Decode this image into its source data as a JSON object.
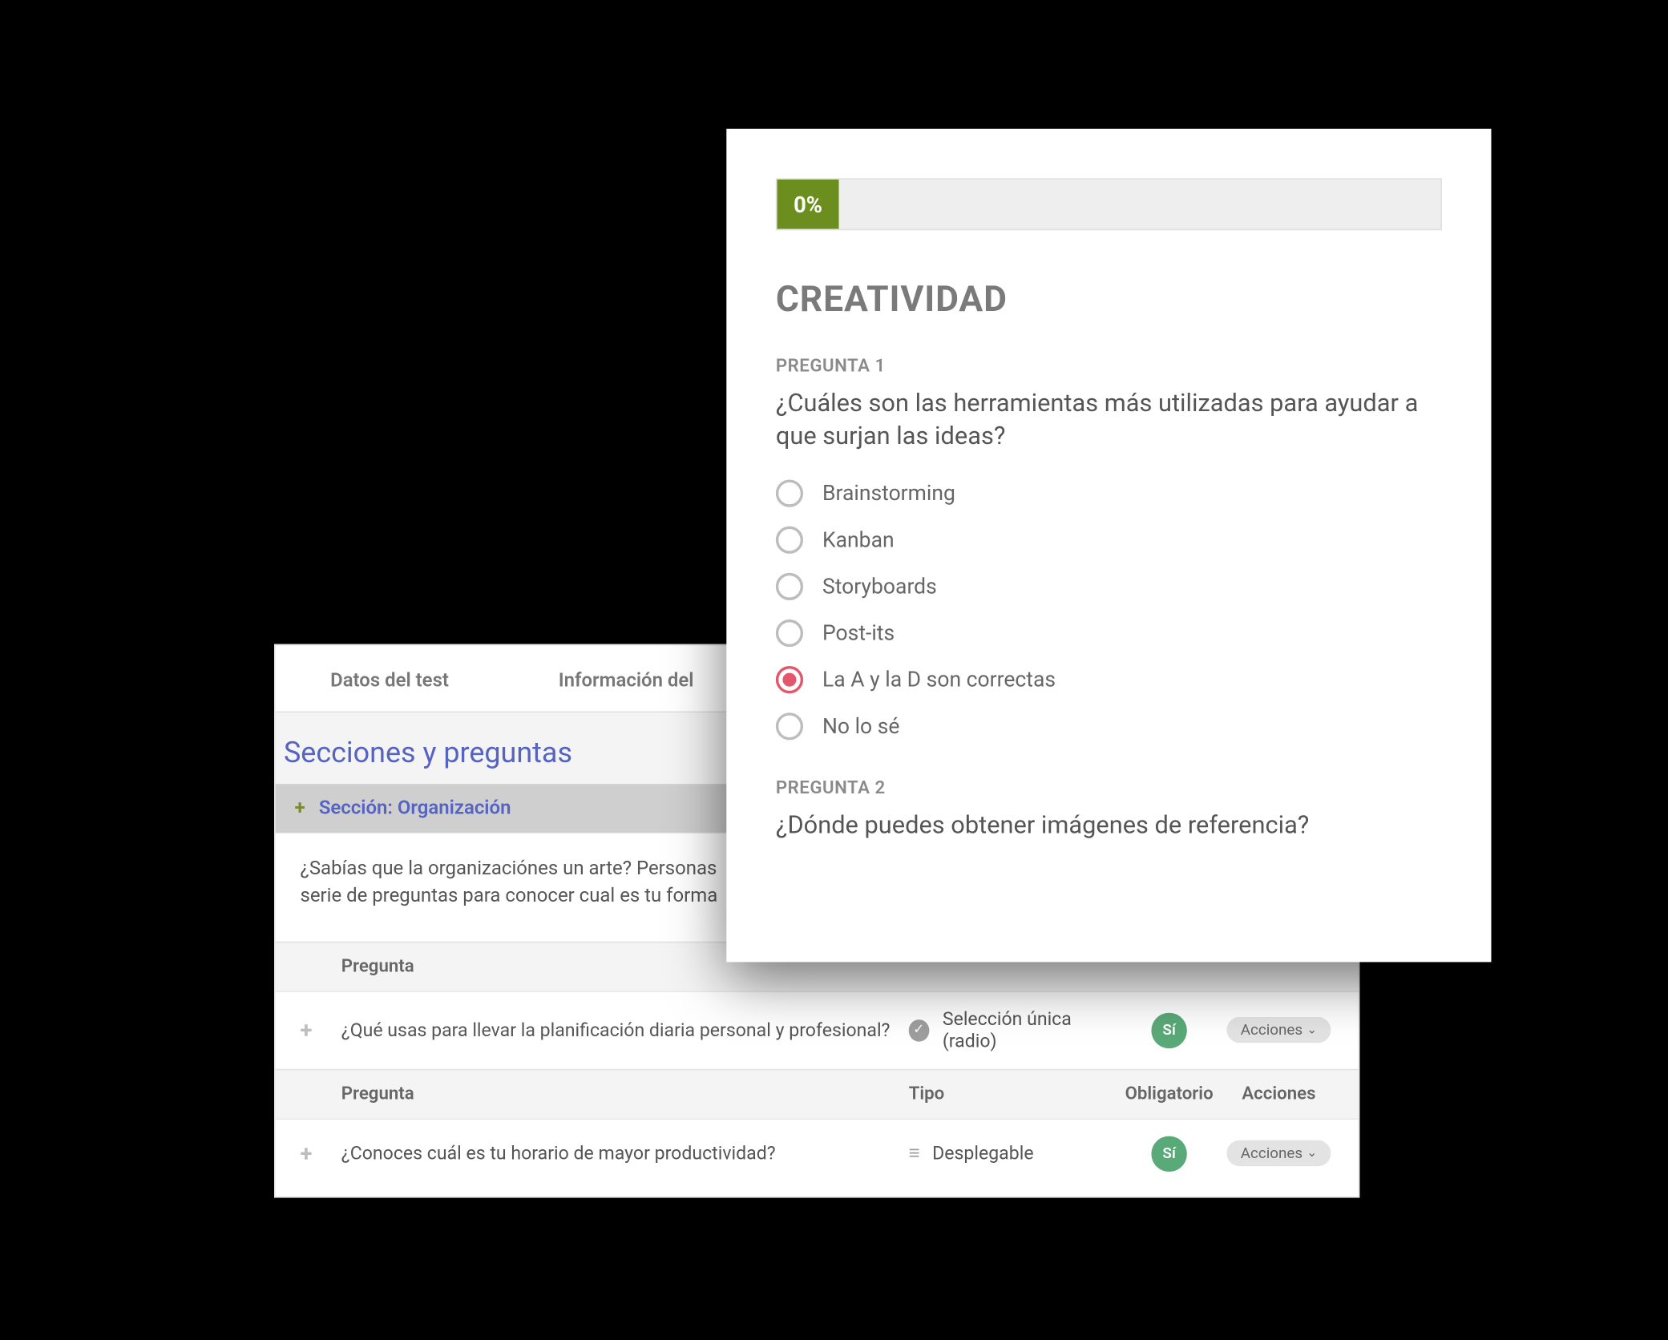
{
  "quiz": {
    "progress": "0%",
    "section_title": "CREATIVIDAD",
    "q1": {
      "label": "PREGUNTA 1",
      "text": "¿Cuáles son las herramientas más utilizadas para ayudar a que surjan las ideas?",
      "opts": {
        "a": "Brainstorming",
        "b": "Kanban",
        "c": "Storyboards",
        "d": "Post-its",
        "e": "La A y la D son correctas",
        "f": "No lo sé"
      }
    },
    "q2": {
      "label": "PREGUNTA 2",
      "text": "¿Dónde puedes obtener imágenes de referencia?"
    }
  },
  "admin": {
    "tabs": {
      "data": "Datos del test",
      "info": "Información del"
    },
    "sp_title": "Secciones y preguntas",
    "section_label": "Sección: Organización",
    "section_desc": "¿Sabías que la organizaciónes un arte? Personas ... serie de preguntas para conocer cual es tu forma",
    "headers": {
      "pregunta": "Pregunta",
      "tipo": "Tipo",
      "obl": "Obligatorio",
      "acc": "Acciones"
    },
    "row1": {
      "q": "¿Qué usas para llevar la planificación diaria personal y profesional?",
      "type": "Selección única (radio)",
      "req": "Sí",
      "act": "Acciones"
    },
    "row2": {
      "q": "¿Conoces cuál es tu horario de mayor productividad?",
      "type": "Desplegable",
      "req": "Sí",
      "act": "Acciones"
    }
  }
}
